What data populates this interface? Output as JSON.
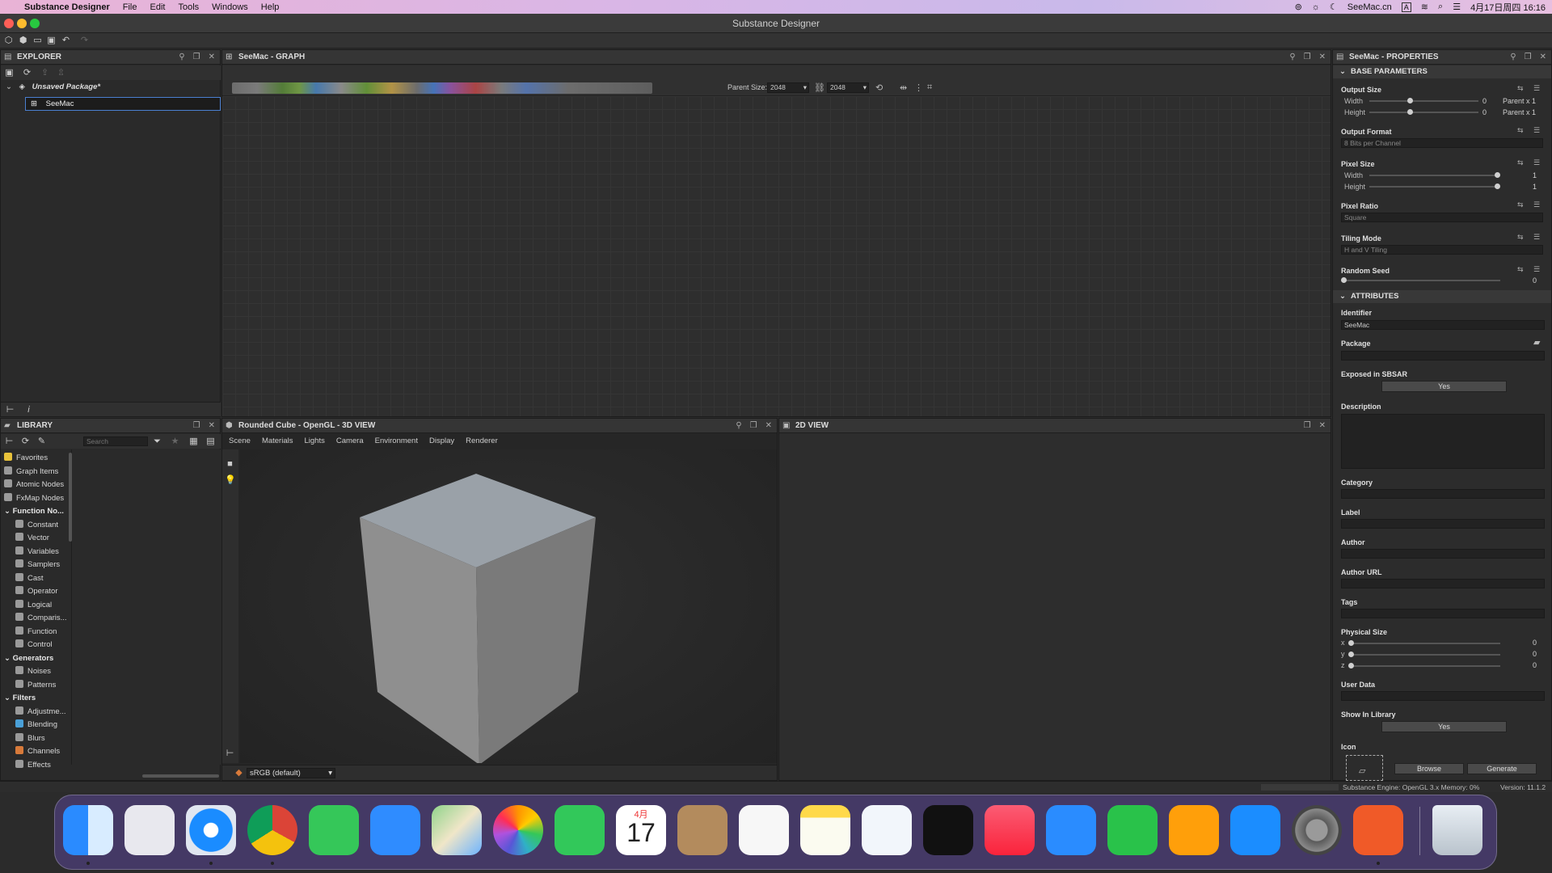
{
  "menubar": {
    "app": "Substance Designer",
    "items": [
      "File",
      "Edit",
      "Tools",
      "Windows",
      "Help"
    ],
    "site": "SeeMac.cn",
    "input": "A",
    "datetime": "4月17日周四 16:16"
  },
  "window": {
    "title": "Substance Designer"
  },
  "explorer": {
    "title": "EXPLORER",
    "package": "Unsaved Package*",
    "graph": "SeeMac"
  },
  "graph": {
    "title": "SeeMac - GRAPH",
    "parent_size_label": "Parent Size:",
    "parent_size_value": "2048",
    "size_value": "2048"
  },
  "library": {
    "title": "LIBRARY",
    "search_placeholder": "Search",
    "items": [
      {
        "label": "Favorites",
        "cat": false,
        "indent": 0,
        "color": "#e8c23a"
      },
      {
        "label": "Graph Items",
        "cat": false,
        "indent": 0,
        "color": "#9a9a9a"
      },
      {
        "label": "Atomic Nodes",
        "cat": false,
        "indent": 0,
        "color": "#9a9a9a"
      },
      {
        "label": "FxMap Nodes",
        "cat": false,
        "indent": 0,
        "color": "#9a9a9a"
      },
      {
        "label": "Function No...",
        "cat": true,
        "indent": 0,
        "color": ""
      },
      {
        "label": "Constant",
        "cat": false,
        "indent": 1,
        "color": "#9a9a9a"
      },
      {
        "label": "Vector",
        "cat": false,
        "indent": 1,
        "color": "#9a9a9a"
      },
      {
        "label": "Variables",
        "cat": false,
        "indent": 1,
        "color": "#9a9a9a"
      },
      {
        "label": "Samplers",
        "cat": false,
        "indent": 1,
        "color": "#9a9a9a"
      },
      {
        "label": "Cast",
        "cat": false,
        "indent": 1,
        "color": "#9a9a9a"
      },
      {
        "label": "Operator",
        "cat": false,
        "indent": 1,
        "color": "#9a9a9a"
      },
      {
        "label": "Logical",
        "cat": false,
        "indent": 1,
        "color": "#9a9a9a"
      },
      {
        "label": "Comparis...",
        "cat": false,
        "indent": 1,
        "color": "#9a9a9a"
      },
      {
        "label": "Function",
        "cat": false,
        "indent": 1,
        "color": "#9a9a9a"
      },
      {
        "label": "Control",
        "cat": false,
        "indent": 1,
        "color": "#9a9a9a"
      },
      {
        "label": "Generators",
        "cat": true,
        "indent": 0,
        "color": ""
      },
      {
        "label": "Noises",
        "cat": false,
        "indent": 1,
        "color": "#9a9a9a"
      },
      {
        "label": "Patterns",
        "cat": false,
        "indent": 1,
        "color": "#9a9a9a"
      },
      {
        "label": "Filters",
        "cat": true,
        "indent": 0,
        "color": ""
      },
      {
        "label": "Adjustme...",
        "cat": false,
        "indent": 1,
        "color": "#9a9a9a"
      },
      {
        "label": "Blending",
        "cat": false,
        "indent": 1,
        "color": "#4aa0d8"
      },
      {
        "label": "Blurs",
        "cat": false,
        "indent": 1,
        "color": "#9a9a9a"
      },
      {
        "label": "Channels",
        "cat": false,
        "indent": 1,
        "color": "#d87a3a"
      },
      {
        "label": "Effects",
        "cat": false,
        "indent": 1,
        "color": "#9a9a9a"
      }
    ]
  },
  "view3d": {
    "title": "Rounded Cube - OpenGL - 3D VIEW",
    "tabs": [
      "Scene",
      "Materials",
      "Lights",
      "Camera",
      "Environment",
      "Display",
      "Renderer"
    ],
    "colorspace": "sRGB (default)"
  },
  "view2d": {
    "title": "2D VIEW"
  },
  "properties": {
    "title": "SeeMac - PROPERTIES",
    "base": "BASE PARAMETERS",
    "output_size": "Output Size",
    "width": "Width",
    "height": "Height",
    "zero": "0",
    "parent": "Parent x 1",
    "output_format": "Output Format",
    "output_format_value": "8 Bits per Channel",
    "pixel_size": "Pixel Size",
    "one": "1",
    "pixel_ratio": "Pixel Ratio",
    "pixel_ratio_value": "Square",
    "tiling_mode": "Tiling Mode",
    "tiling_value": "H and V Tiling",
    "random_seed": "Random Seed",
    "attributes": "ATTRIBUTES",
    "identifier": "Identifier",
    "identifier_value": "SeeMac",
    "package": "Package",
    "exposed": "Exposed in SBSAR",
    "yes": "Yes",
    "description": "Description",
    "category": "Category",
    "label": "Label",
    "author": "Author",
    "author_url": "Author URL",
    "tags": "Tags",
    "physical_size": "Physical Size",
    "x": "x",
    "y": "y",
    "z": "z",
    "user_data": "User Data",
    "show_in_library": "Show In Library",
    "icon": "Icon",
    "browse": "Browse",
    "generate": "Generate"
  },
  "status": {
    "engine": "Substance Engine: OpenGL 3.x  Memory: 0%",
    "version": "Version: 11.1.2"
  },
  "dock": {
    "calendar_month": "4月",
    "calendar_day": "17"
  }
}
